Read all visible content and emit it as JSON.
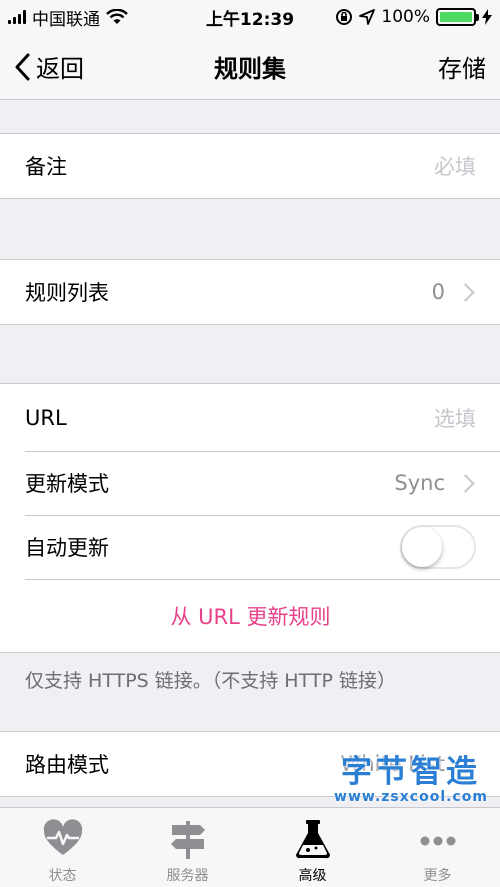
{
  "status_bar": {
    "carrier": "中国联通",
    "time": "上午12:39",
    "battery_percent": "100%",
    "battery_level": 1.0
  },
  "nav": {
    "back_label": "返回",
    "title": "规则集",
    "save_label": "存储"
  },
  "note_row": {
    "label": "备注",
    "placeholder": "必填"
  },
  "rules_row": {
    "label": "规则列表",
    "value": "0"
  },
  "url_group": {
    "url_label": "URL",
    "url_placeholder": "选填",
    "update_mode_label": "更新模式",
    "update_mode_value": "Sync",
    "auto_update_label": "自动更新",
    "auto_update_on": false,
    "update_action": "从 URL 更新规则"
  },
  "footer_note": "仅支持 HTTPS 链接。（不支持 HTTP 链接）",
  "route_row": {
    "label": "路由模式",
    "value": "White List"
  },
  "tabs": [
    {
      "label": "状态",
      "icon": "heart-pulse-icon",
      "active": false
    },
    {
      "label": "服务器",
      "icon": "signpost-icon",
      "active": false
    },
    {
      "label": "高级",
      "icon": "flask-icon",
      "active": true
    },
    {
      "label": "更多",
      "icon": "more-dots-icon",
      "active": false
    }
  ],
  "watermark": {
    "text": "字节智造",
    "url": "www.zsxcool.com"
  },
  "colors": {
    "accent": "#e8418a",
    "battery": "#4cd964",
    "watermark": "#2a7fd4"
  }
}
